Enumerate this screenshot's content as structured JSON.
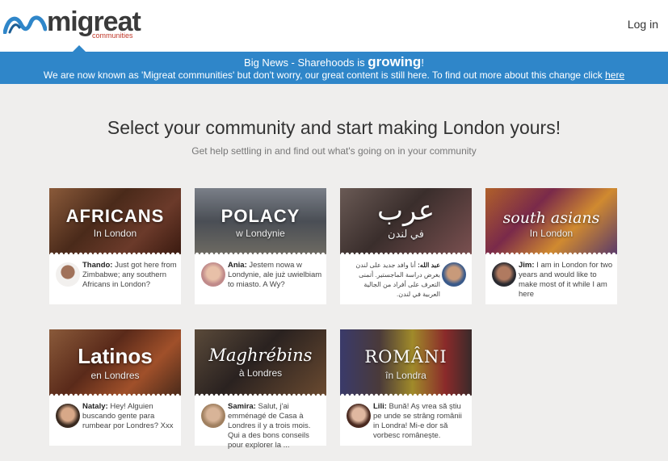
{
  "header": {
    "logo_text": "migreat",
    "logo_sub": "communities",
    "login_label": "Log in"
  },
  "banner": {
    "line1_prefix": "Big News - Sharehoods is ",
    "line1_emph": "growing",
    "line1_suffix": "!",
    "line2_text": "We are now known as 'Migreat communities' but don't worry, our great content is still here. To find out more about this change click ",
    "line2_link": "here"
  },
  "page": {
    "title": "Select your community and start making London yours!",
    "subtitle": "Get help settling in and find out what's going on in your community"
  },
  "cards": [
    {
      "name": "AFRICANS",
      "sub": "In London",
      "author": "Thando:",
      "text": "Just got here from Zimbabwe; any southern Africans in London?",
      "bg": "#6b3a2a"
    },
    {
      "name": "POLACY",
      "sub": "w Londynie",
      "author": "Ania:",
      "text": "Jestem nowa w Londynie, ale już uwielbiam to miasto. A Wy?",
      "bg": "#5a5a60"
    },
    {
      "name": "عرب",
      "sub": "في لندن",
      "author": "عبد الله:",
      "text": "أنا وافد جديد على لندن بغرض دراسة الماجستير. أتمنى التعرف على أفراد من الجالية العربية في لندن.",
      "bg": "#5c4a4a"
    },
    {
      "name": "south asians",
      "sub": "In London",
      "author": "Jim:",
      "text": "I am in London for two years and would like to make most of it while I am here",
      "bg": "#8a4a2a"
    },
    {
      "name": "Latinos",
      "sub": "en Londres",
      "author": "Nataly:",
      "text": "Hey! Alguien buscando gente para rumbear por Londres? Xxx",
      "bg": "#7a4a2a"
    },
    {
      "name": "Maghrébins",
      "sub": "à Londres",
      "author": "Samira:",
      "text": "Salut, j'ai emménagé de Casa à Londres il y a trois mois. Qui a des bons conseils pour explorer la ...",
      "bg": "#4a3a30"
    },
    {
      "name": "ROMÂNI",
      "sub": "în Londra",
      "author": "Lili:",
      "text": "Bună! Aș vrea să știu pe unde se strâng românii in Londra! Mi-e dor să vorbesc românește.",
      "bg": "#5a3a2a"
    }
  ],
  "colors": {
    "banner": "#2f86c9",
    "page_bg": "#efeeed",
    "logo_sub": "#c0392b"
  }
}
